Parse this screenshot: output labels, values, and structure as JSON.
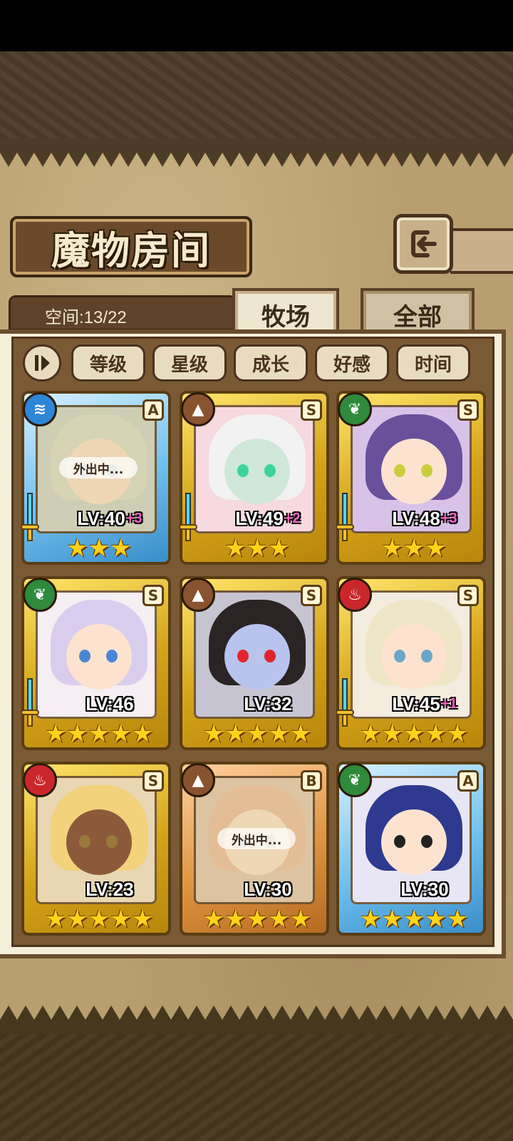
{
  "screen": {
    "title": "魔物房间",
    "capacity": "空间:13/22"
  },
  "tabs": [
    {
      "label": "牧场",
      "active": true
    },
    {
      "label": "全部",
      "active": false
    }
  ],
  "sort": {
    "toggle_icon": "sort-order-icon",
    "buttons": [
      "等级",
      "星级",
      "成长",
      "好感",
      "时间"
    ]
  },
  "monsters": [
    {
      "level": "LV:40",
      "bonus": "+3",
      "rank": "A",
      "element": "water-icon",
      "element_color": "#2d86d6",
      "frame": "blue",
      "stars": "★★★",
      "weapon": "sword-icon",
      "status": "外出中..."
    },
    {
      "level": "LV:49",
      "bonus": "+2",
      "rank": "S",
      "element": "earth-icon",
      "element_color": "#8a5330",
      "frame": "gold",
      "stars": "★★★",
      "weapon": "sword-icon",
      "status": ""
    },
    {
      "level": "LV:48",
      "bonus": "+3",
      "rank": "S",
      "element": "leaf-icon",
      "element_color": "#2f8a3c",
      "frame": "gold",
      "stars": "★★★",
      "weapon": "sword-icon",
      "status": ""
    },
    {
      "level": "LV:46",
      "bonus": "",
      "rank": "S",
      "element": "leaf-icon",
      "element_color": "#2f8a3c",
      "frame": "gold",
      "stars": "★★★★★",
      "weapon": "sword-icon",
      "status": ""
    },
    {
      "level": "LV:32",
      "bonus": "",
      "rank": "S",
      "element": "earth-icon",
      "element_color": "#8a5330",
      "frame": "gold",
      "stars": "★★★★★",
      "weapon": "",
      "status": ""
    },
    {
      "level": "LV:45",
      "bonus": "+1",
      "rank": "S",
      "element": "fire-icon",
      "element_color": "#c9272c",
      "frame": "gold",
      "stars": "★★★★★",
      "weapon": "sword-icon",
      "status": ""
    },
    {
      "level": "LV:23",
      "bonus": "",
      "rank": "S",
      "element": "fire-icon",
      "element_color": "#c9272c",
      "frame": "gold",
      "stars": "★★★★★",
      "weapon": "",
      "status": ""
    },
    {
      "level": "LV:30",
      "bonus": "",
      "rank": "B",
      "element": "earth-icon",
      "element_color": "#8a5330",
      "frame": "bronze",
      "stars": "★★★★★",
      "weapon": "",
      "status": "外出中..."
    },
    {
      "level": "LV:30",
      "bonus": "",
      "rank": "A",
      "element": "leaf-icon",
      "element_color": "#2f8a3c",
      "frame": "blue",
      "stars": "★★★★★",
      "weapon": "",
      "status": ""
    }
  ],
  "colors": {
    "gold_frame": "#d4a218",
    "blue_frame": "#6fc0ee",
    "bronze_frame": "#e0953f",
    "bonus_pink": "#ff5fc6"
  }
}
